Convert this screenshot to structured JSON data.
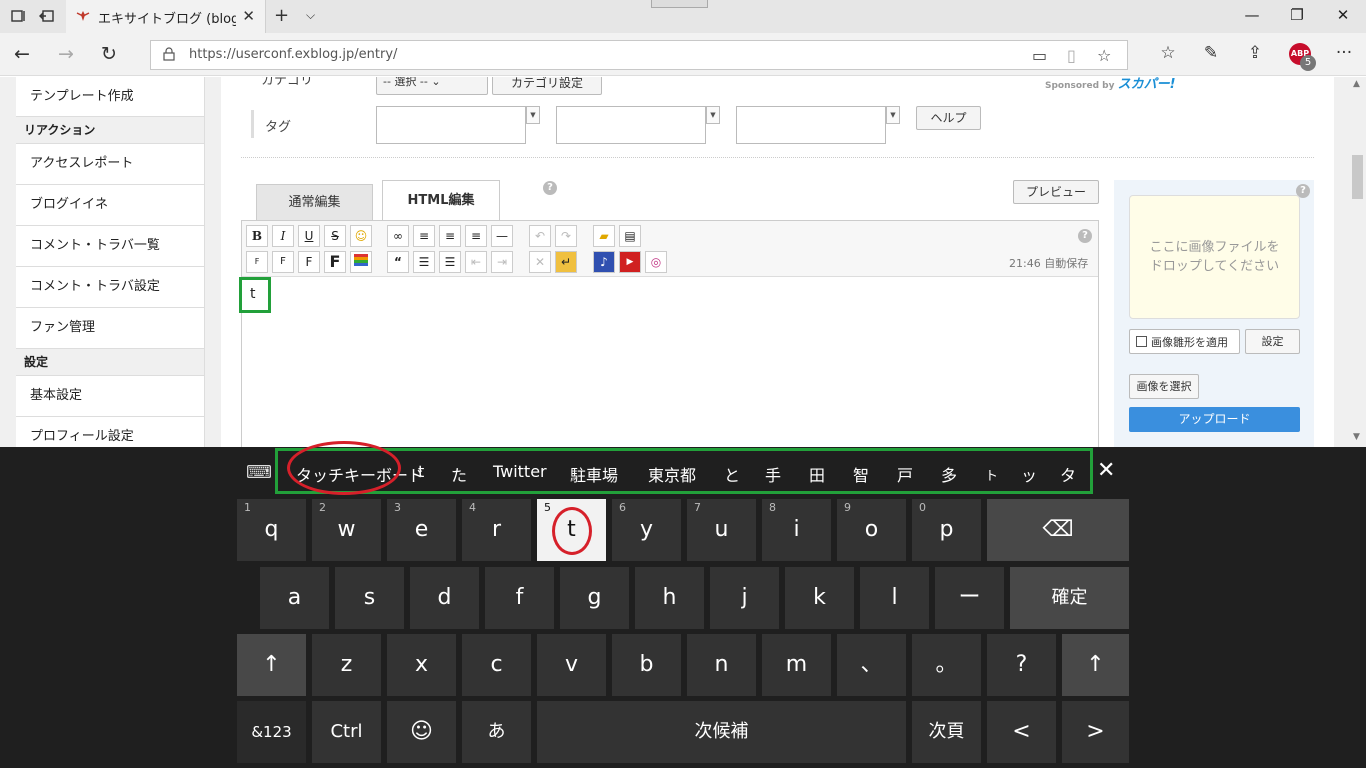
{
  "browser": {
    "tab_title": "エキサイトブログ (blog)|新規",
    "url": "https://userconf.exblog.jp/entry/",
    "abp_label": "ABP",
    "abp_count": "5"
  },
  "sidebar": {
    "items": [
      {
        "type": "item",
        "label": "テンプレート作成"
      },
      {
        "type": "head",
        "label": "リアクション"
      },
      {
        "type": "item",
        "label": "アクセスレポート"
      },
      {
        "type": "item",
        "label": "ブログイイネ"
      },
      {
        "type": "item",
        "label": "コメント・トラバ一覧"
      },
      {
        "type": "item",
        "label": "コメント・トラバ設定"
      },
      {
        "type": "item",
        "label": "ファン管理"
      },
      {
        "type": "head",
        "label": "設定"
      },
      {
        "type": "item",
        "label": "基本設定"
      },
      {
        "type": "item",
        "label": "プロフィール設定"
      }
    ]
  },
  "form": {
    "category_label": "カテゴリ",
    "category_select": "-- 選択 --",
    "category_button": "カテゴリ設定",
    "sponsor_text": "Sponsored by",
    "sponsor_brand": "スカパー!",
    "tag_label": "タグ",
    "help_button": "ヘルプ"
  },
  "editor": {
    "tab_normal": "通常編集",
    "tab_html": "HTML編集",
    "preview_button": "プレビュー",
    "autosave": "21:46 自動保存",
    "content": "t"
  },
  "image_panel": {
    "dropzone_line1": "ここに画像ファイルを",
    "dropzone_line2": "ドロップしてください",
    "checkbox_label": "画像雛形を適用",
    "settings_button": "設定",
    "select_button": "画像を選択",
    "upload_button": "アップロード"
  },
  "keyboard": {
    "candidates": [
      "タッチキーボード",
      "t",
      "た",
      "Twitter",
      "駐車場",
      "東京都",
      "と",
      "手",
      "田",
      "智",
      "戸",
      "多",
      "ト",
      "ッ",
      "タ"
    ],
    "row1": [
      {
        "label": "q",
        "num": "1"
      },
      {
        "label": "w",
        "num": "2"
      },
      {
        "label": "e",
        "num": "3"
      },
      {
        "label": "r",
        "num": "4"
      },
      {
        "label": "t",
        "num": "5"
      },
      {
        "label": "y",
        "num": "6"
      },
      {
        "label": "u",
        "num": "7"
      },
      {
        "label": "i",
        "num": "8"
      },
      {
        "label": "o",
        "num": "9"
      },
      {
        "label": "p",
        "num": "0"
      }
    ],
    "row2": [
      "a",
      "s",
      "d",
      "f",
      "g",
      "h",
      "j",
      "k",
      "l",
      "ー"
    ],
    "enter_label": "確定",
    "row3": [
      "z",
      "x",
      "c",
      "v",
      "b",
      "n",
      "m",
      "、",
      "。",
      "?"
    ],
    "shift_symbol": "↑",
    "backspace_symbol": "⌫",
    "symbols_label": "&123",
    "ctrl_label": "Ctrl",
    "emoji_symbol": "☺",
    "kana_label": "あ",
    "space_label": "次候補",
    "nextpage_label": "次頁",
    "left_symbol": "<",
    "right_symbol": ">"
  }
}
